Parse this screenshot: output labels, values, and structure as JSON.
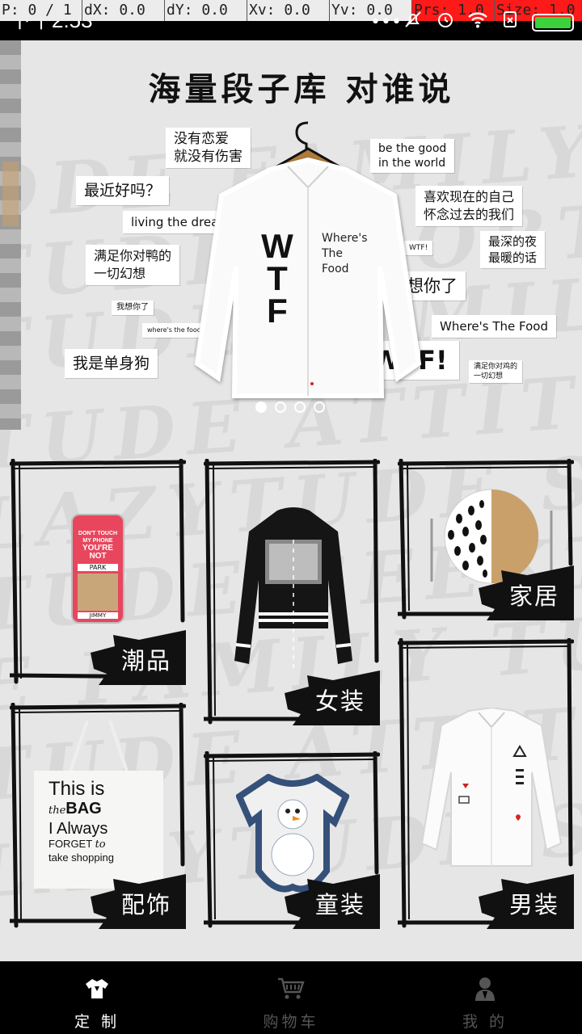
{
  "debug_bar": {
    "cells": [
      "P: 0 / 1",
      "dX: 0.0",
      "dY: 0.0",
      "Xv: 0.0",
      "Yv: 0.0",
      "Prs: 1.0",
      "Size: 1.0"
    ]
  },
  "status_bar": {
    "time": "下午2:53",
    "icons": [
      "more-dots-icon",
      "mute-icon",
      "alarm-icon",
      "wifi-icon",
      "no-sim-icon",
      "battery-icon"
    ]
  },
  "banner": {
    "title": "海量段子库 对谁说",
    "bubbles": [
      "没有恋爱\n就没有伤害",
      "最近好吗？",
      "living the dream",
      "满足你对鸭的\n一切幻想",
      "我想你了",
      "where's the food",
      "我是单身狗",
      "be the good\nin the world",
      "喜欢现在的自己\n怀念过去的我们",
      "WTF!",
      "最深的夜\n最暖的话",
      "我想你了",
      "Where's The Food",
      "WTF!",
      "满足你对鸡的\n一切幻想"
    ],
    "shirt_print_left": "W\nT\nF",
    "shirt_print_right": "Where's\nThe\nFood",
    "carousel": {
      "count": 4,
      "active": 1
    }
  },
  "categories": [
    {
      "label": "潮品",
      "product": "phone-case"
    },
    {
      "label": "女装",
      "product": "cropped-hoodie"
    },
    {
      "label": "家居",
      "product": "plate"
    },
    {
      "label": "配饰",
      "product": "tote-bag",
      "bag_text": [
        "This is",
        "the",
        "BAG",
        "I Always",
        "FORGET",
        "to",
        "take shopping"
      ]
    },
    {
      "label": "童装",
      "product": "baby-romper"
    },
    {
      "label": "男装",
      "product": "white-shirt"
    }
  ],
  "phone_case_text": [
    "DON'T TOUCH",
    "MY PHONE",
    "YOU'RE",
    "NOT",
    "PARK",
    "JIMMY"
  ],
  "bottom_nav": {
    "items": [
      {
        "label": "定 制",
        "icon": "tshirt-icon",
        "active": true
      },
      {
        "label": "购物车",
        "icon": "cart-icon",
        "active": false
      },
      {
        "label": "我 的",
        "icon": "person-icon",
        "active": false
      }
    ]
  },
  "colors": {
    "active_nav": "#ffffff",
    "inactive_nav": "#555555",
    "content_bg": "#e6e6e6",
    "label_brush": "#111111"
  }
}
